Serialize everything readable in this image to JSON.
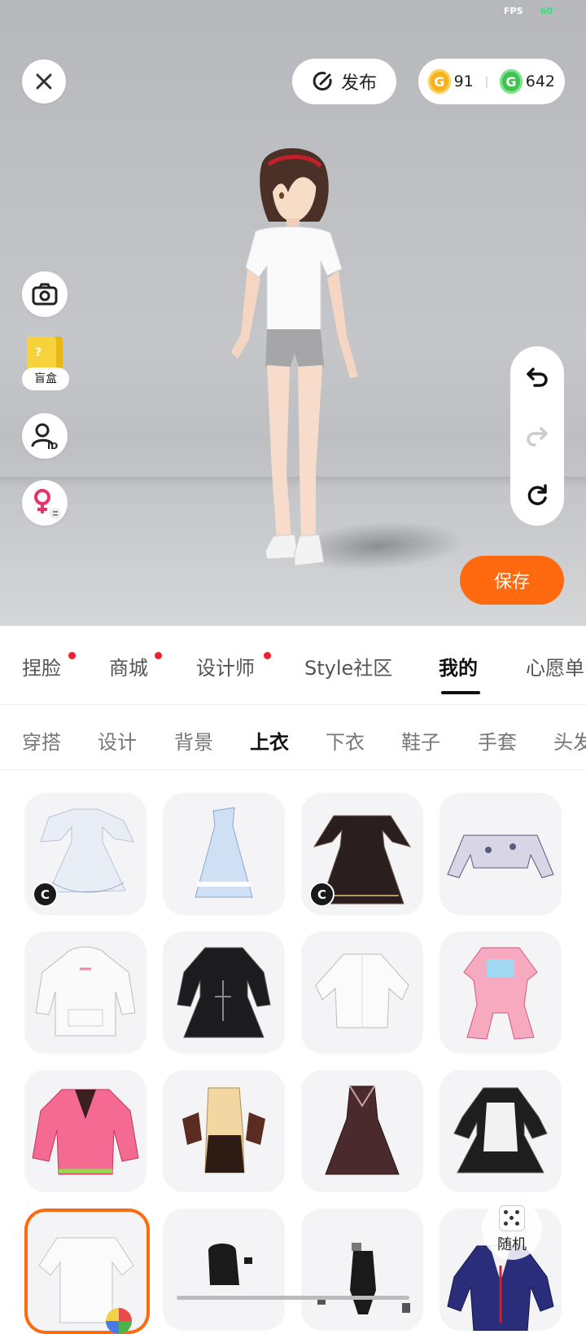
{
  "status": {
    "fps_label": "FPS",
    "fps_value": "60"
  },
  "top_bar": {
    "publish_label": "发布",
    "gold_coins": "91",
    "green_coins": "642",
    "coin_separator": "|"
  },
  "side_tools": {
    "blind_box_label": "盲盒"
  },
  "save_label": "保存",
  "main_tabs": [
    {
      "label": "捏脸",
      "dot": true
    },
    {
      "label": "商城",
      "dot": true
    },
    {
      "label": "设计师",
      "dot": true
    },
    {
      "label": "Style社区",
      "dot": false
    },
    {
      "label": "我的",
      "dot": false,
      "active": true
    },
    {
      "label": "心愿单",
      "dot": false
    }
  ],
  "sub_tabs": [
    {
      "label": "穿搭"
    },
    {
      "label": "设计"
    },
    {
      "label": "背景"
    },
    {
      "label": "上衣",
      "active": true
    },
    {
      "label": "下衣"
    },
    {
      "label": "鞋子"
    },
    {
      "label": "手套"
    },
    {
      "label": "头发"
    }
  ],
  "items": [
    {
      "name": "white-frill-dress",
      "badge": "C"
    },
    {
      "name": "light-blue-dress",
      "badge": ""
    },
    {
      "name": "black-gothic-dress",
      "badge": "C"
    },
    {
      "name": "floral-crop-top",
      "badge": ""
    },
    {
      "name": "white-hoodie",
      "badge": ""
    },
    {
      "name": "black-lolita-dress",
      "badge": ""
    },
    {
      "name": "white-shirt",
      "badge": ""
    },
    {
      "name": "pink-idol-outfit",
      "badge": ""
    },
    {
      "name": "pink-jacket",
      "badge": ""
    },
    {
      "name": "cream-black-outfit",
      "badge": ""
    },
    {
      "name": "dark-brown-dress",
      "badge": ""
    },
    {
      "name": "maid-dress",
      "badge": ""
    },
    {
      "name": "white-tshirt",
      "badge": "",
      "selected": true
    },
    {
      "name": "black-top",
      "badge": ""
    },
    {
      "name": "black-swimsuit",
      "badge": ""
    },
    {
      "name": "navy-uniform-jacket",
      "badge": ""
    }
  ],
  "random_label": "随机",
  "icons": [
    "close-icon",
    "publish-icon",
    "camera-icon",
    "blind-box-icon",
    "id-icon",
    "gender-swap-icon",
    "undo-icon",
    "redo-icon",
    "reset-icon",
    "dice-icon",
    "color-wheel-icon"
  ],
  "colors": {
    "accent": "#ff6a10",
    "gold": "#f6b11b",
    "green": "#3fc451",
    "dot_red": "#f2202e"
  }
}
